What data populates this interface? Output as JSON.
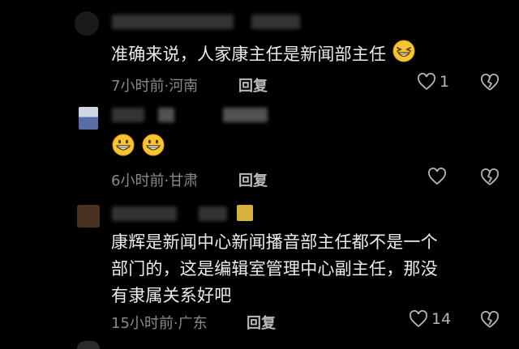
{
  "comments": [
    {
      "text": "准确来说，人家康主任是新闻部主任",
      "time": "7小时前",
      "location": "河南",
      "reply_label": "回复",
      "likes": "1"
    },
    {
      "text": "",
      "time": "6小时前",
      "location": "甘肃",
      "reply_label": "回复",
      "likes": ""
    },
    {
      "text": "康辉是新闻中心新闻播音部主任都不是一个部门的，这是编辑室管理中心副主任，那没有隶属关系好吧",
      "time": "15小时前",
      "location": "广东",
      "reply_label": "回复",
      "likes": "14"
    }
  ],
  "separator": "·",
  "icons": {
    "like": "heart-outline-icon",
    "dislike": "broken-heart-icon",
    "emoji": "grinning-face-emoji"
  },
  "colors": {
    "background": "#000000",
    "text": "#ececec",
    "meta": "#8a8a8a",
    "emoji_yellow": "#f7c531"
  }
}
